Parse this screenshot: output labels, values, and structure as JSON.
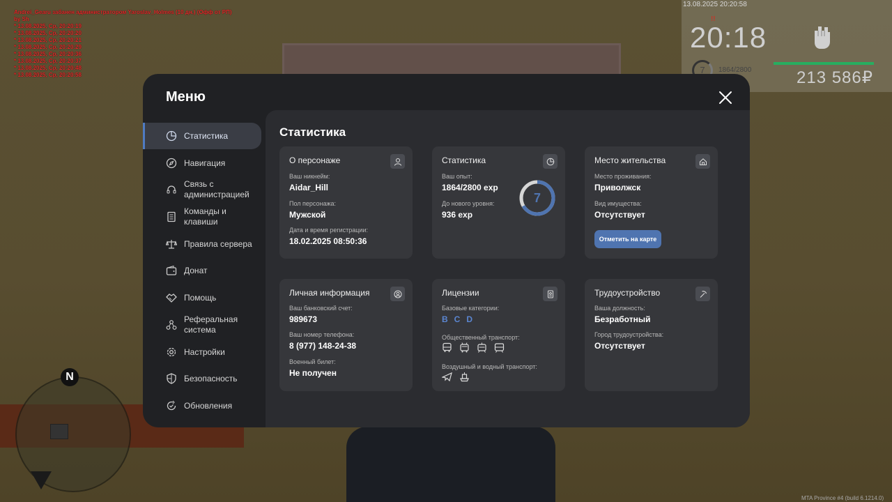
{
  "chat": {
    "messages": [
      "Andrei_Gearu забанен администратором Yaroslav_Holmes (10 дн.) (Офф от РП)",
      "by Sh",
      "* 13.08.2025, Ср, 20:20:19",
      "* 13.08.2025, Ср, 20:20:20",
      "* 13.08.2025, Ср, 20:20:21",
      "* 13.08.2025, Ср, 20:20:29",
      "* 13.08.2025, Ср, 20:20:36",
      "* 13.08.2025, Ср, 20:20:37",
      "* 13.08.2025, Ср, 20:20:48",
      "* 13.08.2025, Ср, 20:20:58"
    ]
  },
  "hud": {
    "date": "13.08.2025 20:20:58",
    "time": "20:18",
    "level": "7",
    "exp": "1864/2800",
    "money": "213 586₽",
    "mark": "!!"
  },
  "radar": {
    "north": "N"
  },
  "build_text": "MTA Province #4 (build 6.1214.0)",
  "menu": {
    "title": "Меню",
    "sidebar": [
      {
        "label": "Статистика",
        "icon": "pie-chart-icon",
        "active": true
      },
      {
        "label": "Навигация",
        "icon": "compass-icon"
      },
      {
        "label": "Связь с администрацией",
        "icon": "headset-icon"
      },
      {
        "label": "Команды и клавиши",
        "icon": "document-icon"
      },
      {
        "label": "Правила сервера",
        "icon": "scales-icon"
      },
      {
        "label": "Донат",
        "icon": "wallet-icon"
      },
      {
        "label": "Помощь",
        "icon": "handshake-icon"
      },
      {
        "label": "Реферальная система",
        "icon": "network-icon"
      },
      {
        "label": "Настройки",
        "icon": "gear-icon"
      },
      {
        "label": "Безопасность",
        "icon": "shield-icon"
      },
      {
        "label": "Обновления",
        "icon": "refresh-check-icon"
      }
    ],
    "content_title": "Статистика",
    "cards": {
      "character": {
        "title": "О персонаже",
        "nickname_label": "Ваш никнейм:",
        "nickname": "Aidar_Hill",
        "gender_label": "Пол персонажа:",
        "gender": "Мужской",
        "reg_label": "Дата и время регистрации:",
        "reg": "18.02.2025 08:50:36"
      },
      "stats": {
        "title": "Статистика",
        "exp_label": "Ваш опыт:",
        "exp": "1864/2800 exp",
        "next_label": "До нового уровня:",
        "next": "936 exp",
        "level": "7",
        "progress": 0.666
      },
      "residence": {
        "title": "Место жительства",
        "place_label": "Место проживания:",
        "place": "Приволжск",
        "property_label": "Вид имущества:",
        "property": "Отсутствует",
        "map_button": "Отметить на карте"
      },
      "personal": {
        "title": "Личная информация",
        "bank_label": "Ваш банковский счет:",
        "bank": "989673",
        "phone_label": "Ваш номер телефона:",
        "phone": "8 (977) 148-24-38",
        "military_label": "Военный билет:",
        "military": "Не получен"
      },
      "licenses": {
        "title": "Лицензии",
        "base_label": "Базовые категории:",
        "categories": [
          "B",
          "C",
          "D"
        ],
        "public_label": "Общественный транспорт:",
        "public_icons": [
          "bus-icon",
          "trolleybus-icon",
          "tram-icon",
          "train-icon"
        ],
        "air_label": "Воздушный и водный транспорт:",
        "air_icons": [
          "plane-icon",
          "boat-icon"
        ]
      },
      "employment": {
        "title": "Трудоустройство",
        "position_label": "Ваша должность:",
        "position": "Безработный",
        "city_label": "Город трудоустройства:",
        "city": "Отсутствует"
      }
    }
  },
  "colors": {
    "accent": "#4f74b0",
    "panel": "#202124",
    "card": "#36373b"
  }
}
